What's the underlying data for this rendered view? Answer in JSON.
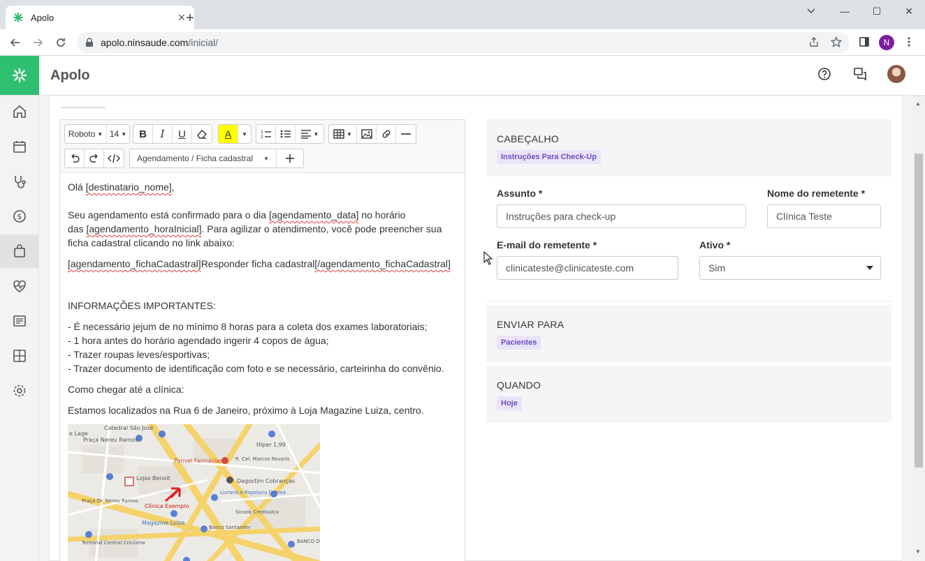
{
  "browser": {
    "tab_title": "Apolo",
    "tab_close": "✕",
    "newtab": "+",
    "url_host": "apolo.ninsaude.com",
    "url_path": "/inicial/",
    "profile_initial": "N",
    "window_min": "—",
    "window_max": "☐",
    "window_close": "✕"
  },
  "app": {
    "title": "Apolo",
    "brand_color": "#2fbf71"
  },
  "editor": {
    "font_family": "Roboto",
    "font_size": "14",
    "bold": "B",
    "italic": "I",
    "underline": "U",
    "color_letter": "A",
    "template_select": "Agendamento / Ficha cadastral",
    "body": {
      "greeting_pre": "Olá ",
      "var_name": "[destinatario_nome]",
      "greeting_post": ",",
      "p1_a": "Seu agendamento está confirmado para o dia ",
      "var_date": "[agendamento_data]",
      "p1_b": " no horário",
      "p1_c": "das ",
      "var_time": "[agendamento_horaInicial]",
      "p1_d": ". Para agilizar o atendimento, você pode preencher sua",
      "p1_e": "ficha cadastral clicando no link abaixo:",
      "var_link_open": "[agendamento_fichaCadastral]",
      "link_text": "Responder ficha cadastral",
      "var_link_close": "[/agendamento_fichaCadastral]",
      "info_title": "INFORMAÇÕES IMPORTANTES:",
      "items": [
        "- É necessário jejum de no mínimo 8 horas para a coleta dos exames laboratoriais;",
        "- 1 hora antes do horário agendado ingerir 4 copos de água;",
        "- Trazer roupas leves/esportivas;",
        "- Trazer documento de identificação com foto e se necessário, carteirinha do convênio."
      ],
      "how_to": "Como chegar até a clínica:",
      "address": "Estamos localizados na Rua 6 de Janeiro, próximo à Loja Magazine Luiza, centro."
    },
    "map_labels": {
      "catedral": "Catedral São José",
      "praca": "Praça Nereu Ramos",
      "hiper": "Hiper 1,99",
      "panvel": "Panvel Farmácias",
      "cel": "R. Cel. Marcos Rovaris",
      "lojas_benoit": "Lojas Benoit",
      "dagostim": "Dagostim Cobranças",
      "livraria": "Livraria e Papelaria Domek",
      "clinica": "Clínica Exemplo",
      "sicoob": "Sicoob Credisulca",
      "magazine": "Magazine Luiza",
      "santander": "Banco Santander",
      "terminal": "Terminal Central Criciúma",
      "banco_do": "BANCO DO",
      "de_lage": "e Lage",
      "praca_dr": "Praça Dr. Nereu Ramos"
    }
  },
  "form": {
    "cabecalho": {
      "title": "CABEÇALHO",
      "chip": "Instruções Para Check-Up"
    },
    "assunto": {
      "label": "Assunto *",
      "value": "Instruções para check-up"
    },
    "remetente_nome": {
      "label": "Nome do remetente *",
      "value": "Clínica Teste"
    },
    "remetente_email": {
      "label": "E-mail do remetente *",
      "value": "clinicateste@clinicateste.com"
    },
    "ativo": {
      "label": "Ativo *",
      "value": "Sim"
    },
    "enviar": {
      "title": "ENVIAR PARA",
      "chip": "Pacientes"
    },
    "quando": {
      "title": "QUANDO",
      "chip": "Hoje"
    }
  }
}
